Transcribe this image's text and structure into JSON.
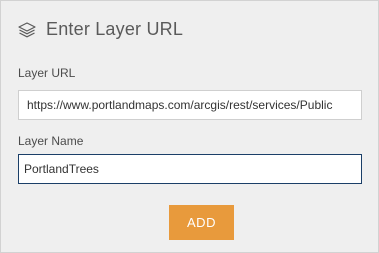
{
  "header": {
    "title": "Enter Layer URL",
    "icon": "layers-icon"
  },
  "url_field": {
    "label": "Layer URL",
    "value": "https://www.portlandmaps.com/arcgis/rest/services/Public"
  },
  "name_field": {
    "label": "Layer Name",
    "value": "PortlandTrees"
  },
  "add_button": {
    "label": "ADD"
  },
  "colors": {
    "accent": "#e89a3c",
    "focus_border": "#1b3f68",
    "background": "#efefef"
  }
}
